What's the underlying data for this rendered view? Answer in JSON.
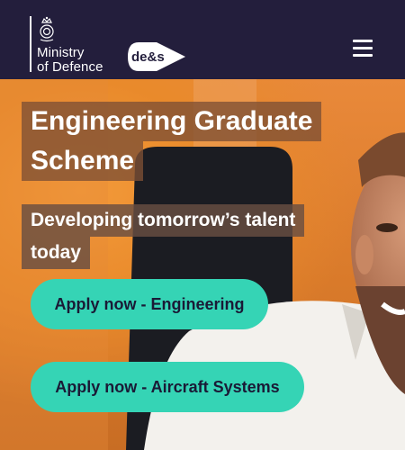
{
  "header": {
    "org_name": "Ministry\nof Defence",
    "partner_logo": "de&s",
    "crest_icon": "royal-crest-icon",
    "menu_icon": "hamburger-menu-icon"
  },
  "hero": {
    "title_line1": "Engineering Graduate",
    "title_line2": "Scheme",
    "subtitle_line1": "Developing tomorrow’s talent",
    "subtitle_line2": "today"
  },
  "buttons": {
    "apply_engineering": "Apply now - Engineering",
    "apply_aircraft": "Apply now - Aircraft Systems"
  },
  "colors": {
    "header_bg": "#231e3c",
    "button_bg": "#35d4b5",
    "button_text": "#1a1a36"
  }
}
